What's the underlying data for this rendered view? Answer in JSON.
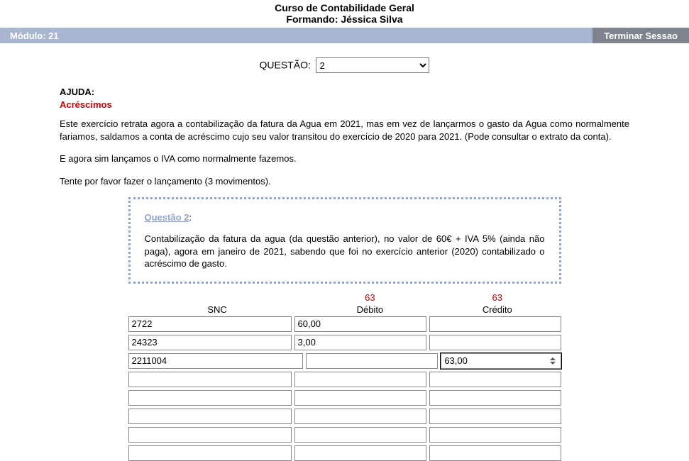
{
  "header": {
    "title": "Curso de Contabilidade Geral",
    "subtitle": "Formando: Jéssica Silva"
  },
  "navbar": {
    "module": "Módulo: 21",
    "logout": "Terminar Sessao"
  },
  "selector": {
    "label": "QUESTÃO:",
    "value": "2"
  },
  "help": {
    "label": "AJUDA",
    "topic": "Acréscimos",
    "p1": "Este exercício retrata agora a contabilização da fatura da Agua em 2021, mas em vez de lançarmos o gasto da Agua como normalmente fariamos, saldamos a conta de acréscimo cujo seu valor transitou do exercício de 2020 para 2021. (Pode consultar o extrato da conta).",
    "p2": "E agora sim lançamos o IVA como normalmente fazemos.",
    "p3": "Tente por favor fazer o lançamento (3 movimentos)."
  },
  "question": {
    "label": "Questão 2",
    "text": "Contabilização da fatura da agua (da questão anterior), no valor de 60€ + IVA 5% (ainda não paga), agora em janeiro de 2021, sabendo que foi no exercício anterior (2020) contabilizado o acréscimo de gasto."
  },
  "sums": {
    "debito": "63",
    "credito": "63"
  },
  "columns": {
    "snc": "SNC",
    "debito": "Débito",
    "credito": "Crédito"
  },
  "rows": [
    {
      "snc": "2722",
      "debito": "60,00",
      "credito": ""
    },
    {
      "snc": "24323",
      "debito": "3,00",
      "credito": ""
    },
    {
      "snc": "2211004",
      "debito": "",
      "credito": "63,00"
    },
    {
      "snc": "",
      "debito": "",
      "credito": ""
    },
    {
      "snc": "",
      "debito": "",
      "credito": ""
    },
    {
      "snc": "",
      "debito": "",
      "credito": ""
    },
    {
      "snc": "",
      "debito": "",
      "credito": ""
    },
    {
      "snc": "",
      "debito": "",
      "credito": ""
    }
  ]
}
